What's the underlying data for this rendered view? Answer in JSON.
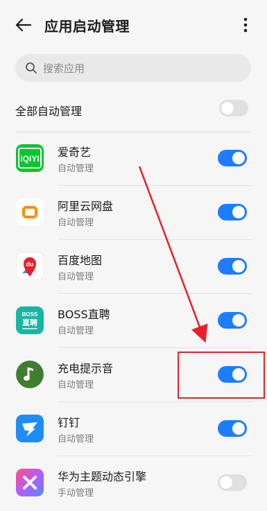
{
  "header": {
    "title": "应用启动管理"
  },
  "search": {
    "placeholder": "搜索应用"
  },
  "all_apps": {
    "label": "全部自动管理",
    "enabled": false
  },
  "apps": [
    {
      "name": "爱奇艺",
      "mode": "自动管理",
      "enabled": true,
      "icon": "iqiyi-icon",
      "icon_text": "iQIYI"
    },
    {
      "name": "阿里云网盘",
      "mode": "自动管理",
      "enabled": true,
      "icon": "aliyun-drive-icon"
    },
    {
      "name": "百度地图",
      "mode": "自动管理",
      "enabled": true,
      "icon": "baidu-map-icon",
      "icon_text": "du"
    },
    {
      "name": "BOSS直聘",
      "mode": "自动管理",
      "enabled": true,
      "icon": "boss-icon",
      "icon_text": "BOSS",
      "icon_text2": "直聘"
    },
    {
      "name": "充电提示音",
      "mode": "自动管理",
      "enabled": true,
      "icon": "music-note-icon"
    },
    {
      "name": "钉钉",
      "mode": "自动管理",
      "enabled": true,
      "icon": "dingtalk-icon"
    },
    {
      "name": "华为主题动态引擎",
      "mode": "手动管理",
      "enabled": false,
      "icon": "huawei-theme-icon"
    }
  ],
  "colors": {
    "toggle_on": "#1d7dff",
    "annotation": "#e8202a"
  }
}
